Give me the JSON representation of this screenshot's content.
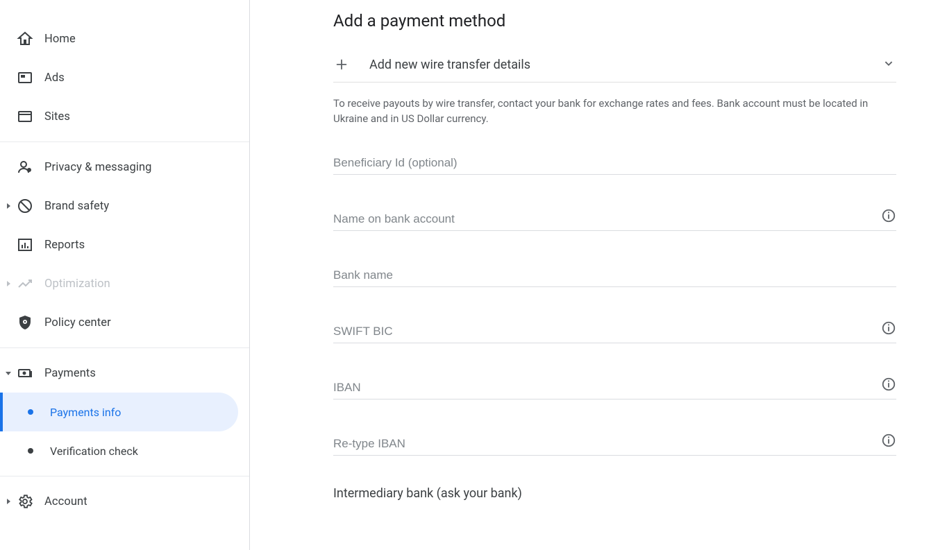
{
  "sidebar": {
    "items": [
      {
        "label": "Home"
      },
      {
        "label": "Ads"
      },
      {
        "label": "Sites"
      },
      {
        "label": "Privacy & messaging"
      },
      {
        "label": "Brand safety"
      },
      {
        "label": "Reports"
      },
      {
        "label": "Optimization"
      },
      {
        "label": "Policy center"
      },
      {
        "label": "Payments",
        "children": [
          {
            "label": "Payments info"
          },
          {
            "label": "Verification check"
          }
        ]
      },
      {
        "label": "Account"
      }
    ]
  },
  "main": {
    "title": "Add a payment method",
    "section_title": "Add new wire transfer details",
    "info_text": "To receive payouts by wire transfer, contact your bank for exchange rates and fees. Bank account must be located in Ukraine and in US Dollar currency.",
    "fields": {
      "beneficiary": "Beneficiary Id (optional)",
      "name_on_account": "Name on bank account",
      "bank_name": "Bank name",
      "swift_bic": "SWIFT BIC",
      "iban": "IBAN",
      "retype_iban": "Re-type IBAN"
    },
    "intermediary_heading": "Intermediary bank (ask your bank)"
  }
}
